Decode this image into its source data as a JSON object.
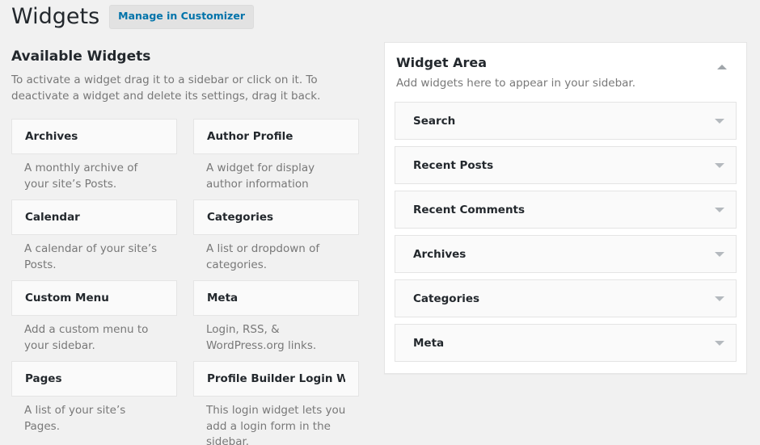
{
  "header": {
    "title": "Widgets",
    "customizer_button": "Manage in Customizer"
  },
  "available": {
    "heading": "Available Widgets",
    "description": "To activate a widget drag it to a sidebar or click on it. To deactivate a widget and delete its settings, drag it back.",
    "widgets": [
      {
        "title": "Archives",
        "description": "A monthly archive of your site’s Posts."
      },
      {
        "title": "Author Profile",
        "description": "A widget for display author information"
      },
      {
        "title": "Calendar",
        "description": "A calendar of your site’s Posts."
      },
      {
        "title": "Categories",
        "description": "A list or dropdown of categories."
      },
      {
        "title": "Custom Menu",
        "description": "Add a custom menu to your sidebar."
      },
      {
        "title": "Meta",
        "description": "Login, RSS, & WordPress.org links."
      },
      {
        "title": "Pages",
        "description": "A list of your site’s Pages."
      },
      {
        "title": "Profile Builder Login Wid…",
        "description": "This login widget lets you add a login form in the sidebar."
      }
    ]
  },
  "sidebar_area": {
    "name": "Widget Area",
    "description": "Add widgets here to appear in your sidebar.",
    "collapse_icon": "triangle-up-icon",
    "expand_icon": "triangle-down-icon",
    "items": [
      {
        "title": "Search"
      },
      {
        "title": "Recent Posts"
      },
      {
        "title": "Recent Comments"
      },
      {
        "title": "Archives"
      },
      {
        "title": "Categories"
      },
      {
        "title": "Meta"
      }
    ]
  },
  "colors": {
    "page_background": "#f1f1f1",
    "card_background": "#fafafa",
    "panel_background": "#ffffff",
    "border": "#e5e5e5",
    "text_primary": "#23282d",
    "text_muted": "#787878",
    "link_blue": "#0073aa",
    "button_background": "#e2e2e2",
    "arrow_gray": "#a0a5aa"
  }
}
